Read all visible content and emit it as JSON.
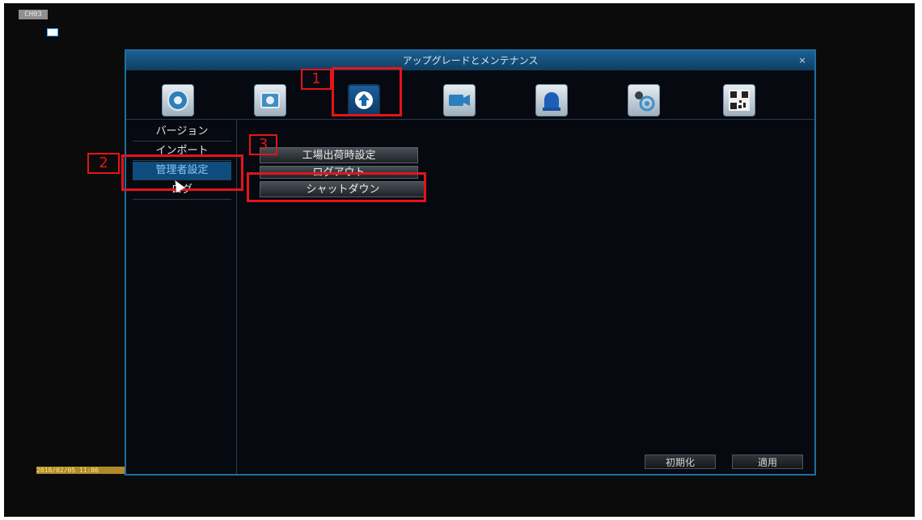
{
  "overlay": {
    "channel_label": "CH03",
    "timestamp": "2018/02/05 11:06"
  },
  "dialog": {
    "title": "アップグレードとメンテナンス",
    "close_glyph": "×"
  },
  "tabs": [
    {
      "icon": "settings-disc-icon",
      "active": false
    },
    {
      "icon": "camera-record-icon",
      "active": false
    },
    {
      "icon": "upgrade-arrow-icon",
      "active": true
    },
    {
      "icon": "video-camera-icon",
      "active": false
    },
    {
      "icon": "alarm-siren-icon",
      "active": false
    },
    {
      "icon": "system-gear-icon",
      "active": false
    },
    {
      "icon": "qr-code-icon",
      "active": false
    }
  ],
  "left_menu": {
    "items": [
      {
        "label": "バージョン"
      },
      {
        "label": "インポート"
      },
      {
        "label": "管理者設定",
        "selected": true
      },
      {
        "label": "ログ"
      }
    ]
  },
  "actions": {
    "factory_reset": "工場出荷時設定",
    "logout": "ログアウト",
    "shutdown": "シャットダウン"
  },
  "footer": {
    "init_label": "初期化",
    "apply_label": "適用"
  },
  "annotations": {
    "step1": "1",
    "step2": "2",
    "step3": "3",
    "color": "#e3141b"
  }
}
